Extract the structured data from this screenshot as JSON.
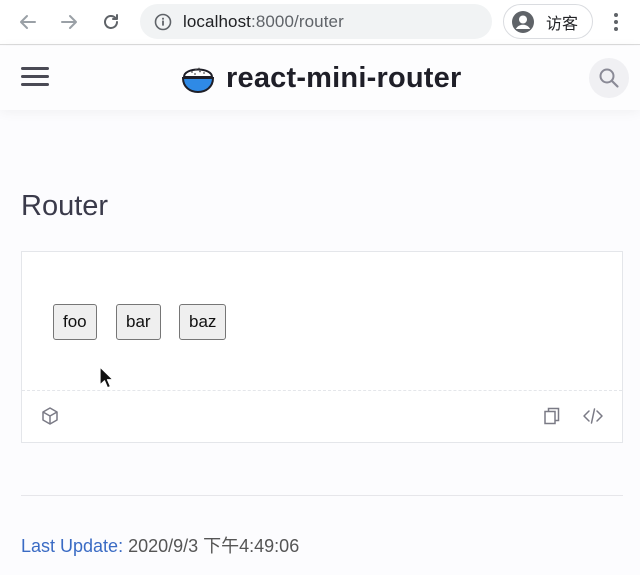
{
  "browser": {
    "url_host": "localhost",
    "url_rest": ":8000/router",
    "profile_name": "访客"
  },
  "header": {
    "site_title": "react-mini-router"
  },
  "main": {
    "page_title": "Router",
    "route_buttons": [
      {
        "label": "foo"
      },
      {
        "label": "bar"
      },
      {
        "label": "baz"
      }
    ],
    "last_update_label": "Last Update:",
    "last_update_value": "2020/9/3 下午4:49:06"
  },
  "colors": {
    "accent_link": "#3a6bc4",
    "logo_blue": "#2f8ae6"
  },
  "icons": {
    "back": "arrow-left-icon",
    "forward": "arrow-right-icon",
    "reload": "reload-icon",
    "info": "info-icon",
    "menu": "hamburger-icon",
    "search": "search-icon",
    "sandbox": "cube-icon",
    "copy": "copy-icon",
    "code": "code-icon"
  }
}
